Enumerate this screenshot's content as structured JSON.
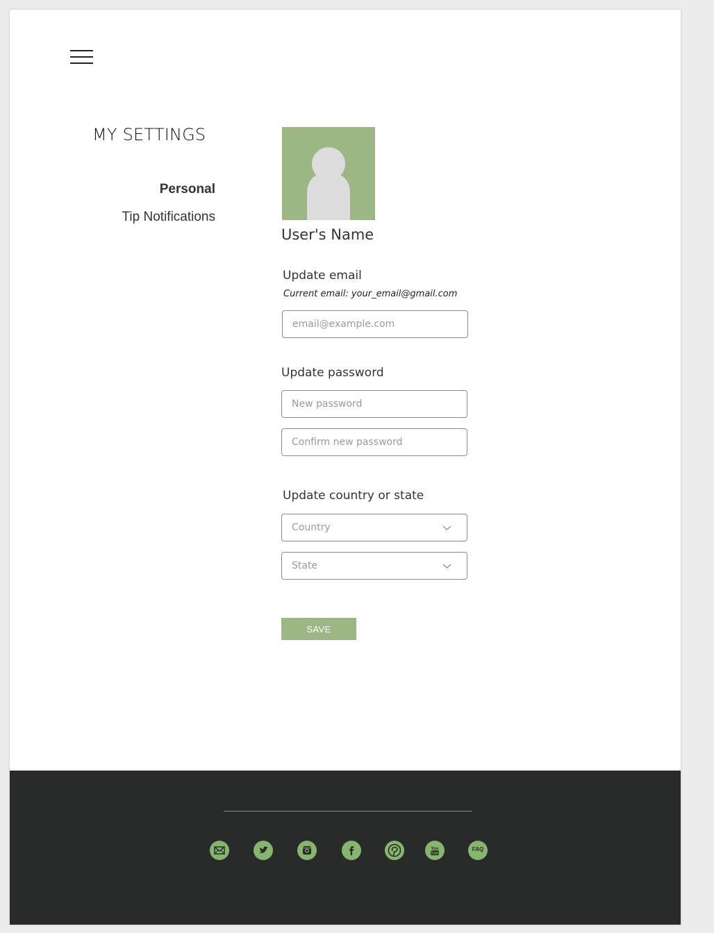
{
  "menu": {
    "icon": "hamburger-icon"
  },
  "sidebar": {
    "title": "MY SETTINGS",
    "items": [
      {
        "label": "Personal",
        "active": true
      },
      {
        "label": "Tip Notifications",
        "active": false
      }
    ]
  },
  "profile": {
    "avatar_icon": "user-avatar-icon",
    "name": "User's Name"
  },
  "email": {
    "label": "Update email",
    "current": "Current email: your_email@gmail.com",
    "placeholder": "email@example.com",
    "value": ""
  },
  "password": {
    "label": "Update password",
    "new_placeholder": "New password",
    "confirm_placeholder": "Confirm new password"
  },
  "location": {
    "label": "Update country or state",
    "country_placeholder": "Country",
    "state_placeholder": "State"
  },
  "save_label": "SAVE",
  "footer": {
    "social_icons": [
      "mail-icon",
      "twitter-icon",
      "instagram-icon",
      "facebook-icon",
      "pinterest-icon",
      "youtube-icon",
      "faq-icon"
    ],
    "youtube_text": "You Tube",
    "faq_label": "FAQ"
  },
  "colors": {
    "accent": "#9cb784",
    "footer_bg": "#292b2a",
    "social_icon_bg": "#86b56e"
  }
}
